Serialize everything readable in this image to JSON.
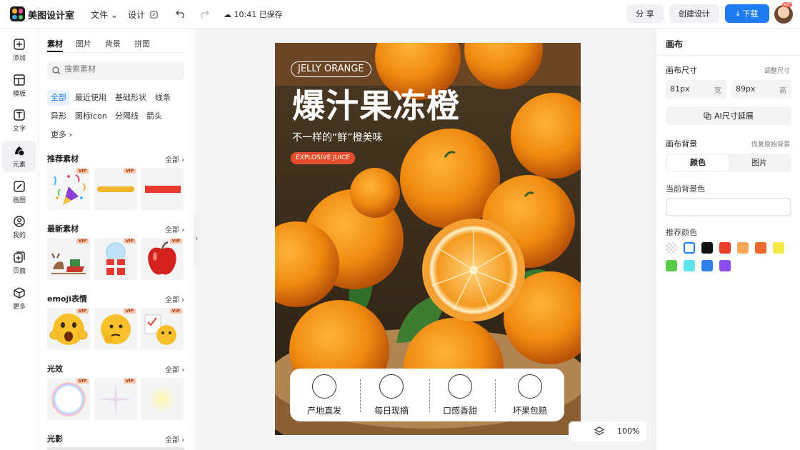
{
  "header": {
    "app_title": "美图设计室",
    "file_menu": "文件",
    "design_menu": "设计",
    "saved_status": "10:41 已保存",
    "share_button": "分 享",
    "create_button": "创建设计",
    "download_button": "下载",
    "avatar_badge": "VIP"
  },
  "rail": [
    {
      "label": "添加",
      "icon": "plus-square-icon"
    },
    {
      "label": "模板",
      "icon": "template-icon"
    },
    {
      "label": "文字",
      "icon": "text-icon"
    },
    {
      "label": "元素",
      "icon": "shapes-icon"
    },
    {
      "label": "画图",
      "icon": "pencil-icon"
    },
    {
      "label": "我的",
      "icon": "user-icon"
    },
    {
      "label": "页面",
      "icon": "add-page-icon"
    },
    {
      "label": "更多",
      "icon": "cube-icon"
    }
  ],
  "panel": {
    "tabs": [
      "素材",
      "图片",
      "背景",
      "拼图"
    ],
    "search_placeholder": "搜索素材",
    "chips": [
      "全部",
      "最近使用",
      "基础形状",
      "线条",
      "异形",
      "图标icon",
      "分隔线",
      "箭头",
      "更多"
    ],
    "sections": [
      {
        "title": "推荐素材",
        "all": "全部"
      },
      {
        "title": "最新素材",
        "all": "全部"
      },
      {
        "title": "emoji表情",
        "all": "全部"
      },
      {
        "title": "光效",
        "all": "全部"
      },
      {
        "title": "光影",
        "all": "全部"
      }
    ],
    "vip_label": "VIP"
  },
  "poster": {
    "pill": "JELLY ORANGE",
    "headline": "爆汁果冻橙",
    "tagline": "不一样的“鲜”橙美味",
    "badge": "EXPLOSIVE JUICE",
    "features": [
      "产地直发",
      "每日现摘",
      "口感香甜",
      "坏果包赔"
    ]
  },
  "zoom": "100%",
  "right_panel": {
    "title": "画布",
    "size_label": "画布尺寸",
    "adjust_link": "调整尺寸",
    "width_value": "81px",
    "width_unit": "宽",
    "height_value": "89px",
    "height_unit": "高",
    "ai_button": "AI尺寸延展",
    "bg_label": "画布背景",
    "restore_link": "恢复原始背景",
    "seg_color": "颜色",
    "seg_image": "图片",
    "current_bg_label": "当前背景色",
    "recommended_label": "推荐颜色",
    "swatches": [
      "transparent",
      "#ffffff",
      "#111111",
      "#e93d2a",
      "#f3a654",
      "#ec6b2a",
      "#f5e94a",
      "#58cc47",
      "#5ee3ee",
      "#2f80ec",
      "#8c4cf0"
    ]
  }
}
